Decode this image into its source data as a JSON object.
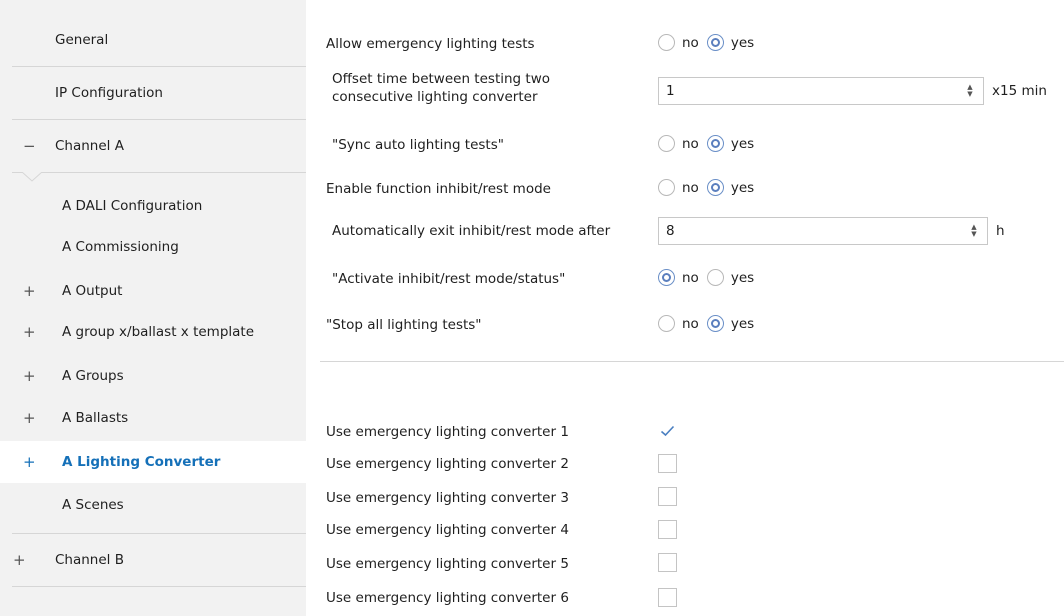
{
  "sidebar": {
    "general": "General",
    "ip_configuration": "IP Configuration",
    "channel_a": {
      "toggle": "−",
      "label": "Channel A"
    },
    "a_dali_configuration": "A DALI Configuration",
    "a_commissioning": "A Commissioning",
    "a_output": {
      "toggle": "+",
      "label": "A Output"
    },
    "a_group_template": {
      "toggle": "+",
      "label": "A group x/ballast x template"
    },
    "a_groups": {
      "toggle": "+",
      "label": "A Groups"
    },
    "a_ballasts": {
      "toggle": "+",
      "label": "A Ballasts"
    },
    "a_lighting_converter": {
      "toggle": "+",
      "label": "A Lighting Converter"
    },
    "a_scenes": "A Scenes",
    "channel_b": {
      "toggle": "+",
      "label": "Channel B"
    }
  },
  "main": {
    "allow_tests": {
      "label": "Allow emergency lighting tests",
      "no": "no",
      "yes": "yes",
      "selected": "yes"
    },
    "offset_time": {
      "label_line1": "Offset time between testing two",
      "label_line2": "consecutive lighting converter",
      "value": "1",
      "unit": "x15 min"
    },
    "sync_auto": {
      "label": "\"Sync auto lighting tests\"",
      "no": "no",
      "yes": "yes",
      "selected": "yes"
    },
    "enable_inhibit": {
      "label": "Enable function inhibit/rest mode",
      "no": "no",
      "yes": "yes",
      "selected": "yes"
    },
    "auto_exit": {
      "label": "Automatically exit inhibit/rest mode after",
      "value": "8",
      "unit": "h"
    },
    "activate_inhibit": {
      "label": "\"Activate inhibit/rest mode/status\"",
      "no": "no",
      "yes": "yes",
      "selected": "no"
    },
    "stop_all": {
      "label": "\"Stop all lighting tests\"",
      "no": "no",
      "yes": "yes",
      "selected": "yes"
    },
    "converters": [
      {
        "label": "Use emergency lighting converter 1",
        "checked": true
      },
      {
        "label": "Use emergency lighting converter 2",
        "checked": false
      },
      {
        "label": "Use emergency lighting converter 3",
        "checked": false
      },
      {
        "label": "Use emergency lighting converter 4",
        "checked": false
      },
      {
        "label": "Use emergency lighting converter 5",
        "checked": false
      },
      {
        "label": "Use emergency lighting converter 6",
        "checked": false
      }
    ]
  },
  "colors": {
    "accent": "#1570b8",
    "sidebar_bg": "#f2f2f2",
    "radio_accent": "#5b7fbe",
    "check": "#4a7fc1"
  }
}
